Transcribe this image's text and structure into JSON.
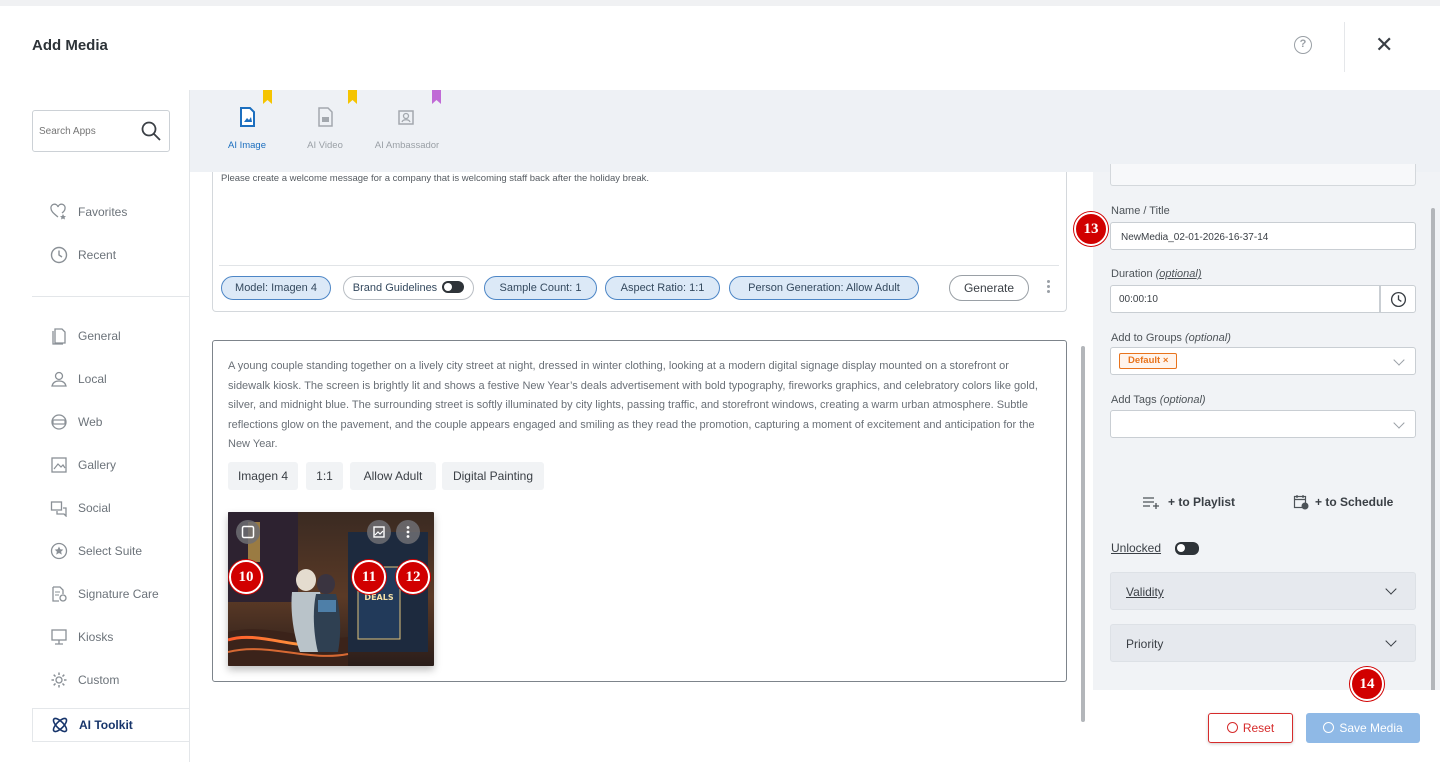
{
  "header": {
    "title": "Add Media",
    "help_icon": "?",
    "close_icon": "✕"
  },
  "sidebar": {
    "search_placeholder": "Search Apps",
    "items_top": [
      {
        "label": "Favorites",
        "icon": "heart-star-icon"
      },
      {
        "label": "Recent",
        "icon": "clock-icon"
      }
    ],
    "items": [
      {
        "label": "General",
        "icon": "document-icon"
      },
      {
        "label": "Local",
        "icon": "user-pin-icon"
      },
      {
        "label": "Web",
        "icon": "globe-window-icon"
      },
      {
        "label": "Gallery",
        "icon": "gallery-icon"
      },
      {
        "label": "Social",
        "icon": "chat-icon"
      },
      {
        "label": "Select Suite",
        "icon": "star-circle-icon"
      },
      {
        "label": "Signature Care",
        "icon": "signature-icon"
      },
      {
        "label": "Kiosks",
        "icon": "kiosk-icon"
      },
      {
        "label": "Custom",
        "icon": "gear-icon"
      },
      {
        "label": "AI Toolkit",
        "icon": "atom-icon",
        "active": true
      }
    ]
  },
  "tabs": [
    {
      "label": "AI Image",
      "active": true,
      "ribbon_color": "#f5c400"
    },
    {
      "label": "AI Video",
      "active": false,
      "ribbon_color": "#f5c400"
    },
    {
      "label": "AI Ambassador",
      "active": false,
      "ribbon_color": "#c06ad6"
    }
  ],
  "prompt": {
    "text": "Please create a welcome message for a company that is welcoming staff back after the holiday break.",
    "model": "Model:  Imagen 4",
    "brand": "Brand Guidelines",
    "sample": "Sample Count:  1",
    "aspect": "Aspect Ratio:  1:1",
    "person": "Person Generation:  Allow Adult",
    "generate": "Generate"
  },
  "result": {
    "description": "A young couple standing together on a lively city street at night, dressed in winter clothing, looking at a modern digital signage display mounted on a storefront or sidewalk kiosk. The screen is brightly lit and shows a festive New Year’s deals advertisement with bold typography, fireworks graphics, and celebratory colors like gold, silver, and midnight blue. The surrounding street is softly illuminated by city lights, passing traffic, and storefront windows, creating a warm urban atmosphere. Subtle reflections glow on the pavement, and the couple appears engaged and smiling as they read the promotion, capturing a moment of excitement and anticipation for the New Year.",
    "tags": [
      "Imagen 4",
      "1:1",
      "Allow Adult",
      "Digital Painting"
    ],
    "thumb_sign_text": "DEALS"
  },
  "badges": {
    "b10": "10",
    "b11": "11",
    "b12": "12",
    "b13": "13",
    "b14": "14"
  },
  "form": {
    "name_label": "Name / Title",
    "name_value": "NewMedia_02-01-2026-16-37-14",
    "duration_label": "Duration",
    "duration_opt": "(optional)",
    "duration_value": "00:00:10",
    "groups_label": "Add to Groups",
    "groups_opt": "(optional)",
    "group_chip": "Default  ×",
    "tags_label": "Add Tags",
    "tags_opt": "(optional)",
    "to_playlist": "+ to Playlist",
    "to_schedule": "+ to Schedule",
    "unlocked": "Unlocked",
    "validity": "Validity",
    "priority": "Priority",
    "reset": "Reset",
    "save": "Save Media"
  },
  "colors": {
    "accent": "#1c6fbf",
    "badge": "#d10000",
    "chip": "#e8731c",
    "reset": "#d62b2b",
    "save": "#8fb9e6"
  }
}
